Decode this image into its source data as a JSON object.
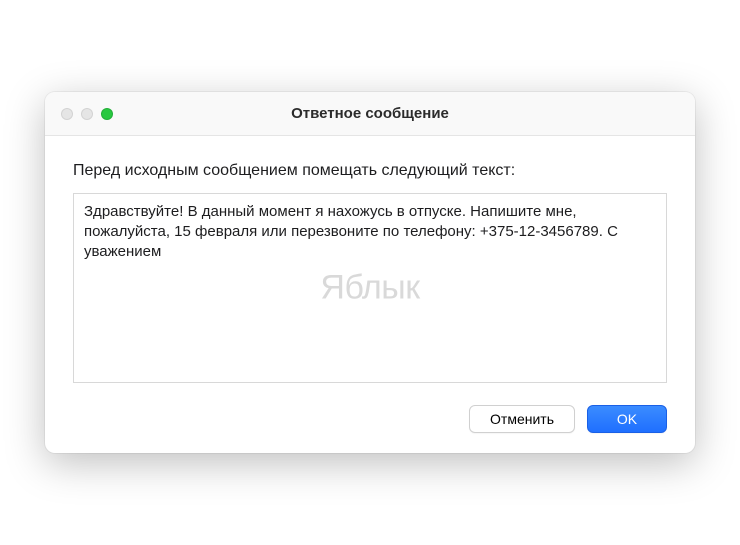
{
  "window": {
    "title": "Ответное сообщение"
  },
  "content": {
    "label": "Перед исходным сообщением помещать следующий текст:",
    "textarea_value": "Здравствуйте! В данный момент я нахожусь в отпуске. Напишите мне, пожалуйста, 15 февраля или перезвоните по телефону: +375-12-3456789. С уважением",
    "watermark": "Яблык"
  },
  "buttons": {
    "cancel": "Отменить",
    "ok": "OK"
  }
}
